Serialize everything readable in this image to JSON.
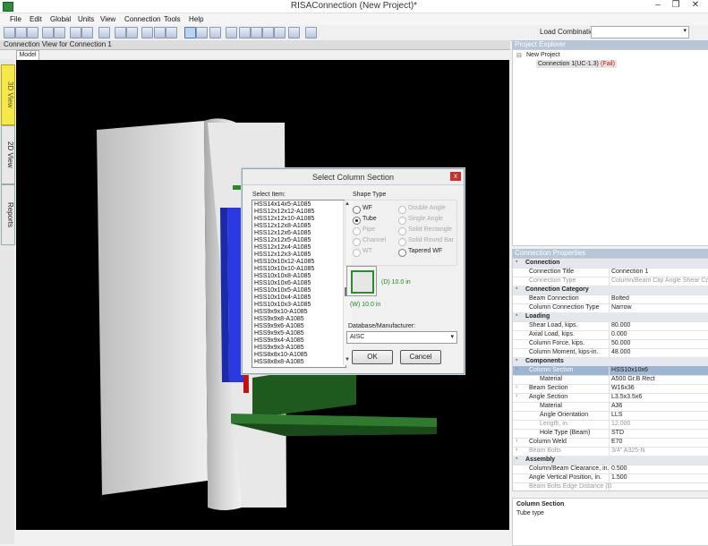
{
  "window": {
    "title": "RISAConnection (New Project)*"
  },
  "menu": [
    "File",
    "Edit",
    "Global",
    "Units",
    "View",
    "Connection",
    "Tools",
    "Help"
  ],
  "toolbar": {
    "load_combination_label": "Load Combination:"
  },
  "viewport": {
    "header": "Connection View for Connection 1",
    "tab": "Model"
  },
  "side_tabs": [
    "3D View",
    "2D View",
    "Reports"
  ],
  "dialog": {
    "title": "Select Column Section",
    "close": "x",
    "select_item_label": "Select Item:",
    "items": [
      "HSS14x14x5-A1085",
      "HSS12x12x12-A1085",
      "HSS12x12x10-A1085",
      "HSS12x12x8-A1085",
      "HSS12x12x6-A1085",
      "HSS12x12x5-A1085",
      "HSS12x12x4-A1085",
      "HSS12x12x3-A1085",
      "HSS10x10x12-A1085",
      "HSS10x10x10-A1085",
      "HSS10x10x8-A1085",
      "HSS10x10x6-A1085",
      "HSS10x10x5-A1085",
      "HSS10x10x4-A1085",
      "HSS10x10x3-A1085",
      "HSS9x9x10-A1085",
      "HSS9x9x8-A1085",
      "HSS9x9x6-A1085",
      "HSS9x9x5-A1085",
      "HSS9x9x4-A1085",
      "HSS9x9x3-A1085",
      "HSS8x8x10-A1085",
      "HSS8x8x8-A1085"
    ],
    "shape_type_label": "Shape Type",
    "shapes_left": [
      {
        "label": "WF",
        "state": "off"
      },
      {
        "label": "Tube",
        "state": "on"
      },
      {
        "label": "Pipe",
        "state": "disabled"
      },
      {
        "label": "Channel",
        "state": "disabled"
      },
      {
        "label": "WT",
        "state": "disabled"
      }
    ],
    "shapes_right": [
      {
        "label": "Double Angle",
        "state": "disabled"
      },
      {
        "label": "Single Angle",
        "state": "disabled"
      },
      {
        "label": "Solid Rectangle",
        "state": "disabled"
      },
      {
        "label": "Solid Round Bar",
        "state": "disabled"
      },
      {
        "label": "Tapered WF",
        "state": "off"
      }
    ],
    "dim_d": "(D) 10.0 in",
    "dim_w": "(W) 10.0 in",
    "db_label": "Database/Manufacturer:",
    "db_value": "AISC",
    "ok": "OK",
    "cancel": "Cancel"
  },
  "project_explorer": {
    "header": "Project Explorer",
    "root": "New Project",
    "child_name": "Connection 1",
    "child_code": "(UC-1.3)",
    "child_status": "(Fail)"
  },
  "properties": {
    "header": "Connection Properties",
    "rows": [
      {
        "type": "cat",
        "label": "Connection",
        "value": ""
      },
      {
        "type": "p1",
        "label": "Connection Title",
        "value": "Connection 1"
      },
      {
        "type": "p1",
        "label": "Connection Type",
        "value": "Column/Beam Clip Angle Shear Conn",
        "grey": true
      },
      {
        "type": "cat",
        "label": "Connection Category",
        "value": ""
      },
      {
        "type": "p1",
        "label": "Beam Connection",
        "value": "Bolted"
      },
      {
        "type": "p1",
        "label": "Column Connection Type",
        "value": "Narrow"
      },
      {
        "type": "cat",
        "label": "Loading",
        "value": ""
      },
      {
        "type": "p1",
        "label": "Shear Load, kips.",
        "value": "80.000"
      },
      {
        "type": "p1",
        "label": "Axial Load, kips.",
        "value": "0.000"
      },
      {
        "type": "p1",
        "label": "Column Force, kips.",
        "value": "50.000"
      },
      {
        "type": "p1",
        "label": "Column Moment, kips-in.",
        "value": "48.000"
      },
      {
        "type": "cat",
        "label": "Components",
        "value": ""
      },
      {
        "type": "sel",
        "label": "Column Section",
        "value": "HSS10x10x6"
      },
      {
        "type": "p2",
        "label": "Material",
        "value": "A500 Gr.B Rect"
      },
      {
        "type": "p1e",
        "label": "Beam Section",
        "value": "W16x36"
      },
      {
        "type": "p1e",
        "label": "Angle Section",
        "value": "L3.5x3.5x6"
      },
      {
        "type": "p2",
        "label": "Material",
        "value": "A36"
      },
      {
        "type": "p2",
        "label": "Angle Orientation",
        "value": "LLS"
      },
      {
        "type": "p2",
        "label": "Length, in.",
        "value": "12.000",
        "grey": true
      },
      {
        "type": "p2",
        "label": "Hole Type (Beam)",
        "value": "STD"
      },
      {
        "type": "p1e",
        "label": "Column Weld",
        "value": "E70"
      },
      {
        "type": "p1e",
        "label": "Beam Bolts",
        "value": "3/4\" A325-N",
        "grey": true
      },
      {
        "type": "cat",
        "label": "Assembly",
        "value": ""
      },
      {
        "type": "p1",
        "label": "Column/Beam Clearance, in.",
        "value": "0.500"
      },
      {
        "type": "p1",
        "label": "Angle Vertical Position, in.",
        "value": "1.500"
      },
      {
        "type": "p1",
        "label": "Beam Bolts Edge Distance (D",
        "value": "",
        "grey": true
      }
    ]
  },
  "description": {
    "title": "Column Section",
    "text": "Tube type"
  }
}
